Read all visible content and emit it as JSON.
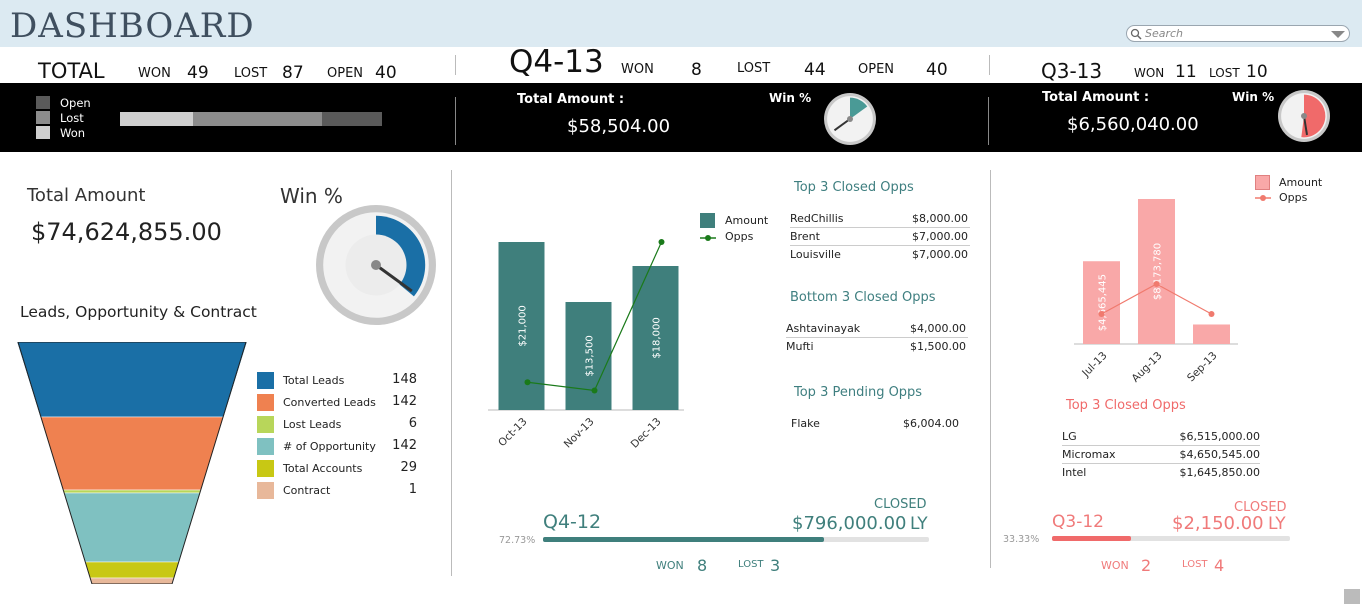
{
  "header": {
    "title": "DASHBOARD",
    "search_placeholder": "Search"
  },
  "total": {
    "label": "TOTAL",
    "won_label": "WON",
    "won": "49",
    "lost_label": "LOST",
    "lost": "87",
    "open_label": "OPEN",
    "open": "40"
  },
  "q4": {
    "label": "Q4-13",
    "won_label": "WON",
    "won": "8",
    "lost_label": "LOST",
    "lost": "44",
    "open_label": "OPEN",
    "open": "40",
    "amount_label": "Total Amount :",
    "amount": "$58,504.00",
    "win_label": "Win %",
    "win_fraction": 0.15
  },
  "q3": {
    "label": "Q3-13",
    "won_label": "WON",
    "won": "11",
    "lost_label": "LOST",
    "lost": "10",
    "amount_label": "Total Amount :",
    "amount": "$6,560,040.00",
    "win_label": "Win %",
    "win_fraction": 0.52
  },
  "status_legend": [
    {
      "label": "Open",
      "color": "#5a5a5a"
    },
    {
      "label": "Lost",
      "color": "#8c8c8c"
    },
    {
      "label": "Won",
      "color": "#cfcfcf"
    }
  ],
  "status_bar": [
    {
      "name": "Won",
      "value": 49,
      "color": "#cfcfcf"
    },
    {
      "name": "Lost",
      "value": 87,
      "color": "#8c8c8c"
    },
    {
      "name": "Open",
      "value": 40,
      "color": "#5a5a5a"
    }
  ],
  "overall": {
    "amount_label": "Total Amount",
    "amount": "$74,624,855.00",
    "win_label": "Win %",
    "win_fraction": 0.36
  },
  "funnel": {
    "title": "Leads, Opportunity & Contract",
    "items": [
      {
        "label": "Total Leads",
        "value": "148",
        "color": "#1a6fa6"
      },
      {
        "label": "Converted Leads",
        "value": "142",
        "color": "#ef8150"
      },
      {
        "label": "Lost Leads",
        "value": "6",
        "color": "#b8d65a"
      },
      {
        "label": "# of Opportunity",
        "value": "142",
        "color": "#7fc1c1"
      },
      {
        "label": "Total Accounts",
        "value": "29",
        "color": "#c8c814"
      },
      {
        "label": "Contract",
        "value": "1",
        "color": "#e8b89a"
      }
    ]
  },
  "q4_chart": {
    "legend_amount": "Amount",
    "legend_opps": "Opps",
    "chart_data": {
      "type": "bar",
      "categories": [
        "Oct-13",
        "Nov-13",
        "Dec-13"
      ],
      "series": [
        {
          "name": "Amount",
          "values": [
            21000,
            13500,
            18000
          ],
          "labels": [
            "$21,000",
            "$13,500",
            "$18,000"
          ],
          "color": "#3f7f7c"
        },
        {
          "name": "Opps",
          "values": [
            3,
            2,
            20
          ],
          "color": "#1a7a1a"
        }
      ]
    }
  },
  "q4_top_closed": {
    "title": "Top 3 Closed Opps",
    "rows": [
      {
        "name": "RedChillis",
        "value": "$8,000.00"
      },
      {
        "name": "Brent",
        "value": "$7,000.00"
      },
      {
        "name": "Louisville",
        "value": "$7,000.00"
      }
    ]
  },
  "q4_bottom_closed": {
    "title": "Bottom 3 Closed Opps",
    "rows": [
      {
        "name": "Ashtavinayak",
        "value": "$4,000.00"
      },
      {
        "name": "Mufti",
        "value": "$1,500.00"
      }
    ]
  },
  "q4_pending": {
    "title": "Top 3 Pending Opps",
    "rows": [
      {
        "name": "Flake",
        "value": "$6,004.00"
      }
    ]
  },
  "q4_ly": {
    "closed_label": "CLOSED",
    "period": "Q4-12",
    "amount": "$796,000.00",
    "ly": "LY",
    "percent": "72.73%",
    "progress": 0.7273,
    "won_label": "WON",
    "won": "8",
    "lost_label": "LOST",
    "lost": "3",
    "color": "#3f7f7c"
  },
  "q3_chart": {
    "legend_amount": "Amount",
    "legend_opps": "Opps",
    "chart_data": {
      "type": "bar",
      "categories": [
        "Jul-13",
        "Aug-13",
        "Sep-13"
      ],
      "series": [
        {
          "name": "Amount",
          "values": [
            4665445,
            8173780,
            1100000
          ],
          "labels": [
            "$4,665,445",
            "$8,173,780",
            ""
          ],
          "color": "#f9a8a8"
        },
        {
          "name": "Opps",
          "values": [
            4,
            6,
            4
          ],
          "color": "#f07a6e"
        }
      ]
    }
  },
  "q3_top_closed": {
    "title": "Top 3 Closed Opps",
    "rows": [
      {
        "name": "LG",
        "value": "$6,515,000.00"
      },
      {
        "name": "Micromax",
        "value": "$4,650,545.00"
      },
      {
        "name": "Intel",
        "value": "$1,645,850.00"
      }
    ]
  },
  "q3_ly": {
    "closed_label": "CLOSED",
    "period": "Q3-12",
    "amount": "$2,150.00",
    "ly": "LY",
    "percent": "33.33%",
    "progress": 0.3333,
    "won_label": "WON",
    "won": "2",
    "lost_label": "LOST",
    "lost": "4",
    "color": "#f07a6e"
  }
}
